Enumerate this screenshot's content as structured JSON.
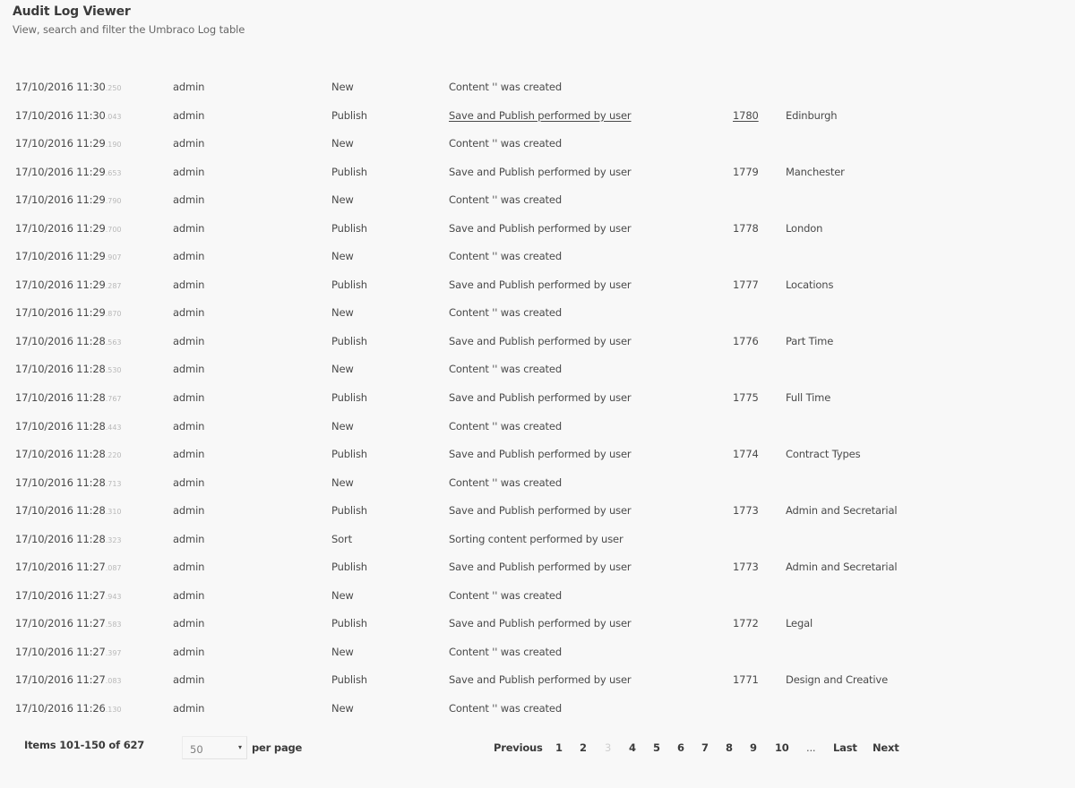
{
  "header": {
    "title": "Audit Log Viewer",
    "subtitle": "View, search and filter the Umbraco Log table"
  },
  "log": [
    {
      "date": "17/10/2016 11:30",
      "ms": ".250",
      "user": "admin",
      "type": "New",
      "comment": "Content '' was created",
      "node_id": "",
      "node_name": ""
    },
    {
      "date": "17/10/2016 11:30",
      "ms": ".043",
      "user": "admin",
      "type": "Publish",
      "comment": "Save and Publish performed by user",
      "node_id": "1780",
      "node_name": "Edinburgh",
      "hover": true
    },
    {
      "date": "17/10/2016 11:29",
      "ms": ".190",
      "user": "admin",
      "type": "New",
      "comment": "Content '' was created",
      "node_id": "",
      "node_name": ""
    },
    {
      "date": "17/10/2016 11:29",
      "ms": ".653",
      "user": "admin",
      "type": "Publish",
      "comment": "Save and Publish performed by user",
      "node_id": "1779",
      "node_name": "Manchester"
    },
    {
      "date": "17/10/2016 11:29",
      "ms": ".790",
      "user": "admin",
      "type": "New",
      "comment": "Content '' was created",
      "node_id": "",
      "node_name": ""
    },
    {
      "date": "17/10/2016 11:29",
      "ms": ".700",
      "user": "admin",
      "type": "Publish",
      "comment": "Save and Publish performed by user",
      "node_id": "1778",
      "node_name": "London"
    },
    {
      "date": "17/10/2016 11:29",
      "ms": ".907",
      "user": "admin",
      "type": "New",
      "comment": "Content '' was created",
      "node_id": "",
      "node_name": ""
    },
    {
      "date": "17/10/2016 11:29",
      "ms": ".287",
      "user": "admin",
      "type": "Publish",
      "comment": "Save and Publish performed by user",
      "node_id": "1777",
      "node_name": "Locations"
    },
    {
      "date": "17/10/2016 11:29",
      "ms": ".870",
      "user": "admin",
      "type": "New",
      "comment": "Content '' was created",
      "node_id": "",
      "node_name": ""
    },
    {
      "date": "17/10/2016 11:28",
      "ms": ".563",
      "user": "admin",
      "type": "Publish",
      "comment": "Save and Publish performed by user",
      "node_id": "1776",
      "node_name": "Part Time"
    },
    {
      "date": "17/10/2016 11:28",
      "ms": ".530",
      "user": "admin",
      "type": "New",
      "comment": "Content '' was created",
      "node_id": "",
      "node_name": ""
    },
    {
      "date": "17/10/2016 11:28",
      "ms": ".767",
      "user": "admin",
      "type": "Publish",
      "comment": "Save and Publish performed by user",
      "node_id": "1775",
      "node_name": "Full Time"
    },
    {
      "date": "17/10/2016 11:28",
      "ms": ".443",
      "user": "admin",
      "type": "New",
      "comment": "Content '' was created",
      "node_id": "",
      "node_name": ""
    },
    {
      "date": "17/10/2016 11:28",
      "ms": ".220",
      "user": "admin",
      "type": "Publish",
      "comment": "Save and Publish performed by user",
      "node_id": "1774",
      "node_name": "Contract Types"
    },
    {
      "date": "17/10/2016 11:28",
      "ms": ".713",
      "user": "admin",
      "type": "New",
      "comment": "Content '' was created",
      "node_id": "",
      "node_name": ""
    },
    {
      "date": "17/10/2016 11:28",
      "ms": ".310",
      "user": "admin",
      "type": "Publish",
      "comment": "Save and Publish performed by user",
      "node_id": "1773",
      "node_name": "Admin and Secretarial"
    },
    {
      "date": "17/10/2016 11:28",
      "ms": ".323",
      "user": "admin",
      "type": "Sort",
      "comment": "Sorting content performed by user",
      "node_id": "",
      "node_name": ""
    },
    {
      "date": "17/10/2016 11:27",
      "ms": ".087",
      "user": "admin",
      "type": "Publish",
      "comment": "Save and Publish performed by user",
      "node_id": "1773",
      "node_name": "Admin and Secretarial"
    },
    {
      "date": "17/10/2016 11:27",
      "ms": ".943",
      "user": "admin",
      "type": "New",
      "comment": "Content '' was created",
      "node_id": "",
      "node_name": ""
    },
    {
      "date": "17/10/2016 11:27",
      "ms": ".583",
      "user": "admin",
      "type": "Publish",
      "comment": "Save and Publish performed by user",
      "node_id": "1772",
      "node_name": "Legal"
    },
    {
      "date": "17/10/2016 11:27",
      "ms": ".397",
      "user": "admin",
      "type": "New",
      "comment": "Content '' was created",
      "node_id": "",
      "node_name": ""
    },
    {
      "date": "17/10/2016 11:27",
      "ms": ".083",
      "user": "admin",
      "type": "Publish",
      "comment": "Save and Publish performed by user",
      "node_id": "1771",
      "node_name": "Design and Creative"
    },
    {
      "date": "17/10/2016 11:26",
      "ms": ".130",
      "user": "admin",
      "type": "New",
      "comment": "Content '' was created",
      "node_id": "",
      "node_name": ""
    }
  ],
  "footer": {
    "items_label": "Items 101-150 of 627",
    "per_page_value": "50",
    "per_page_caret": "▾",
    "per_page_label": "per page"
  },
  "pagination": {
    "items": [
      {
        "label": "Previous",
        "kind": "prev"
      },
      {
        "label": "1",
        "kind": "page"
      },
      {
        "label": "2",
        "kind": "page"
      },
      {
        "label": "3",
        "kind": "page",
        "active": true
      },
      {
        "label": "4",
        "kind": "page"
      },
      {
        "label": "5",
        "kind": "page"
      },
      {
        "label": "6",
        "kind": "page"
      },
      {
        "label": "7",
        "kind": "page"
      },
      {
        "label": "8",
        "kind": "page"
      },
      {
        "label": "9",
        "kind": "page"
      },
      {
        "label": "10",
        "kind": "page"
      },
      {
        "label": "...",
        "kind": "ellipsis"
      },
      {
        "label": "Last",
        "kind": "last"
      },
      {
        "label": "Next",
        "kind": "next"
      }
    ]
  }
}
